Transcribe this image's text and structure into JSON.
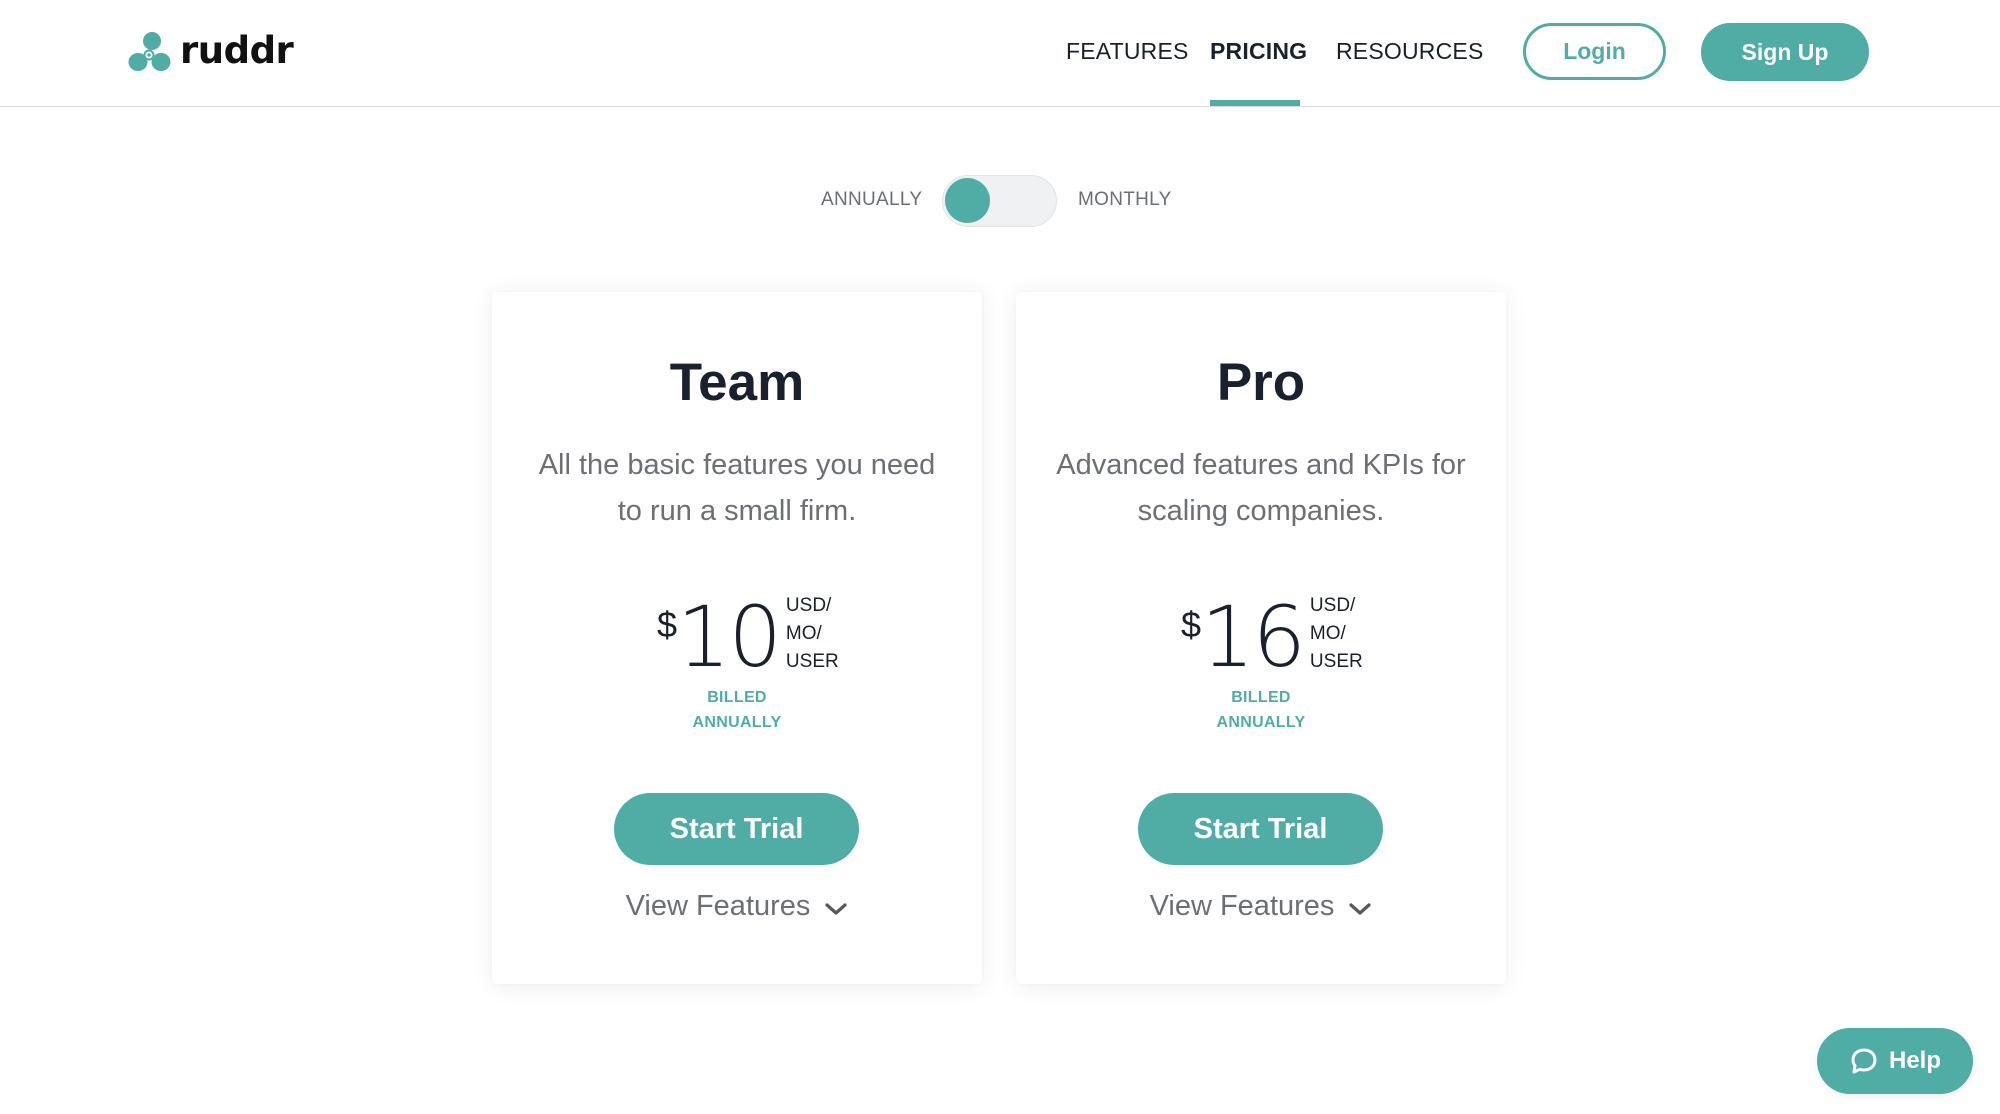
{
  "brand": {
    "name": "ruddr",
    "logo_icon": "propeller-logo-icon",
    "accent_color": "#4fada6"
  },
  "header": {
    "nav": [
      {
        "label": "FEATURES",
        "active": false
      },
      {
        "label": "PRICING",
        "active": true
      },
      {
        "label": "RESOURCES",
        "active": false
      }
    ],
    "login_label": "Login",
    "signup_label": "Sign Up"
  },
  "billing_toggle": {
    "left_label": "ANNUALLY",
    "right_label": "MONTHLY",
    "selected": "ANNUALLY"
  },
  "plans": [
    {
      "name": "Team",
      "description": "All the basic features you need to run a small firm.",
      "currency_symbol": "$",
      "price": "10",
      "unit_lines": [
        "USD/",
        "MO/",
        "USER"
      ],
      "billed_lines": [
        "BILLED",
        "ANNUALLY"
      ],
      "cta_label": "Start Trial",
      "features_label": "View Features",
      "features_icon": "chevron-down-icon"
    },
    {
      "name": "Pro",
      "description": "Advanced features and KPIs for scaling companies.",
      "currency_symbol": "$",
      "price": "16",
      "unit_lines": [
        "USD/",
        "MO/",
        "USER"
      ],
      "billed_lines": [
        "BILLED",
        "ANNUALLY"
      ],
      "cta_label": "Start Trial",
      "features_label": "View Features",
      "features_icon": "chevron-down-icon"
    }
  ],
  "help": {
    "label": "Help",
    "icon": "chat-bubble-icon"
  }
}
